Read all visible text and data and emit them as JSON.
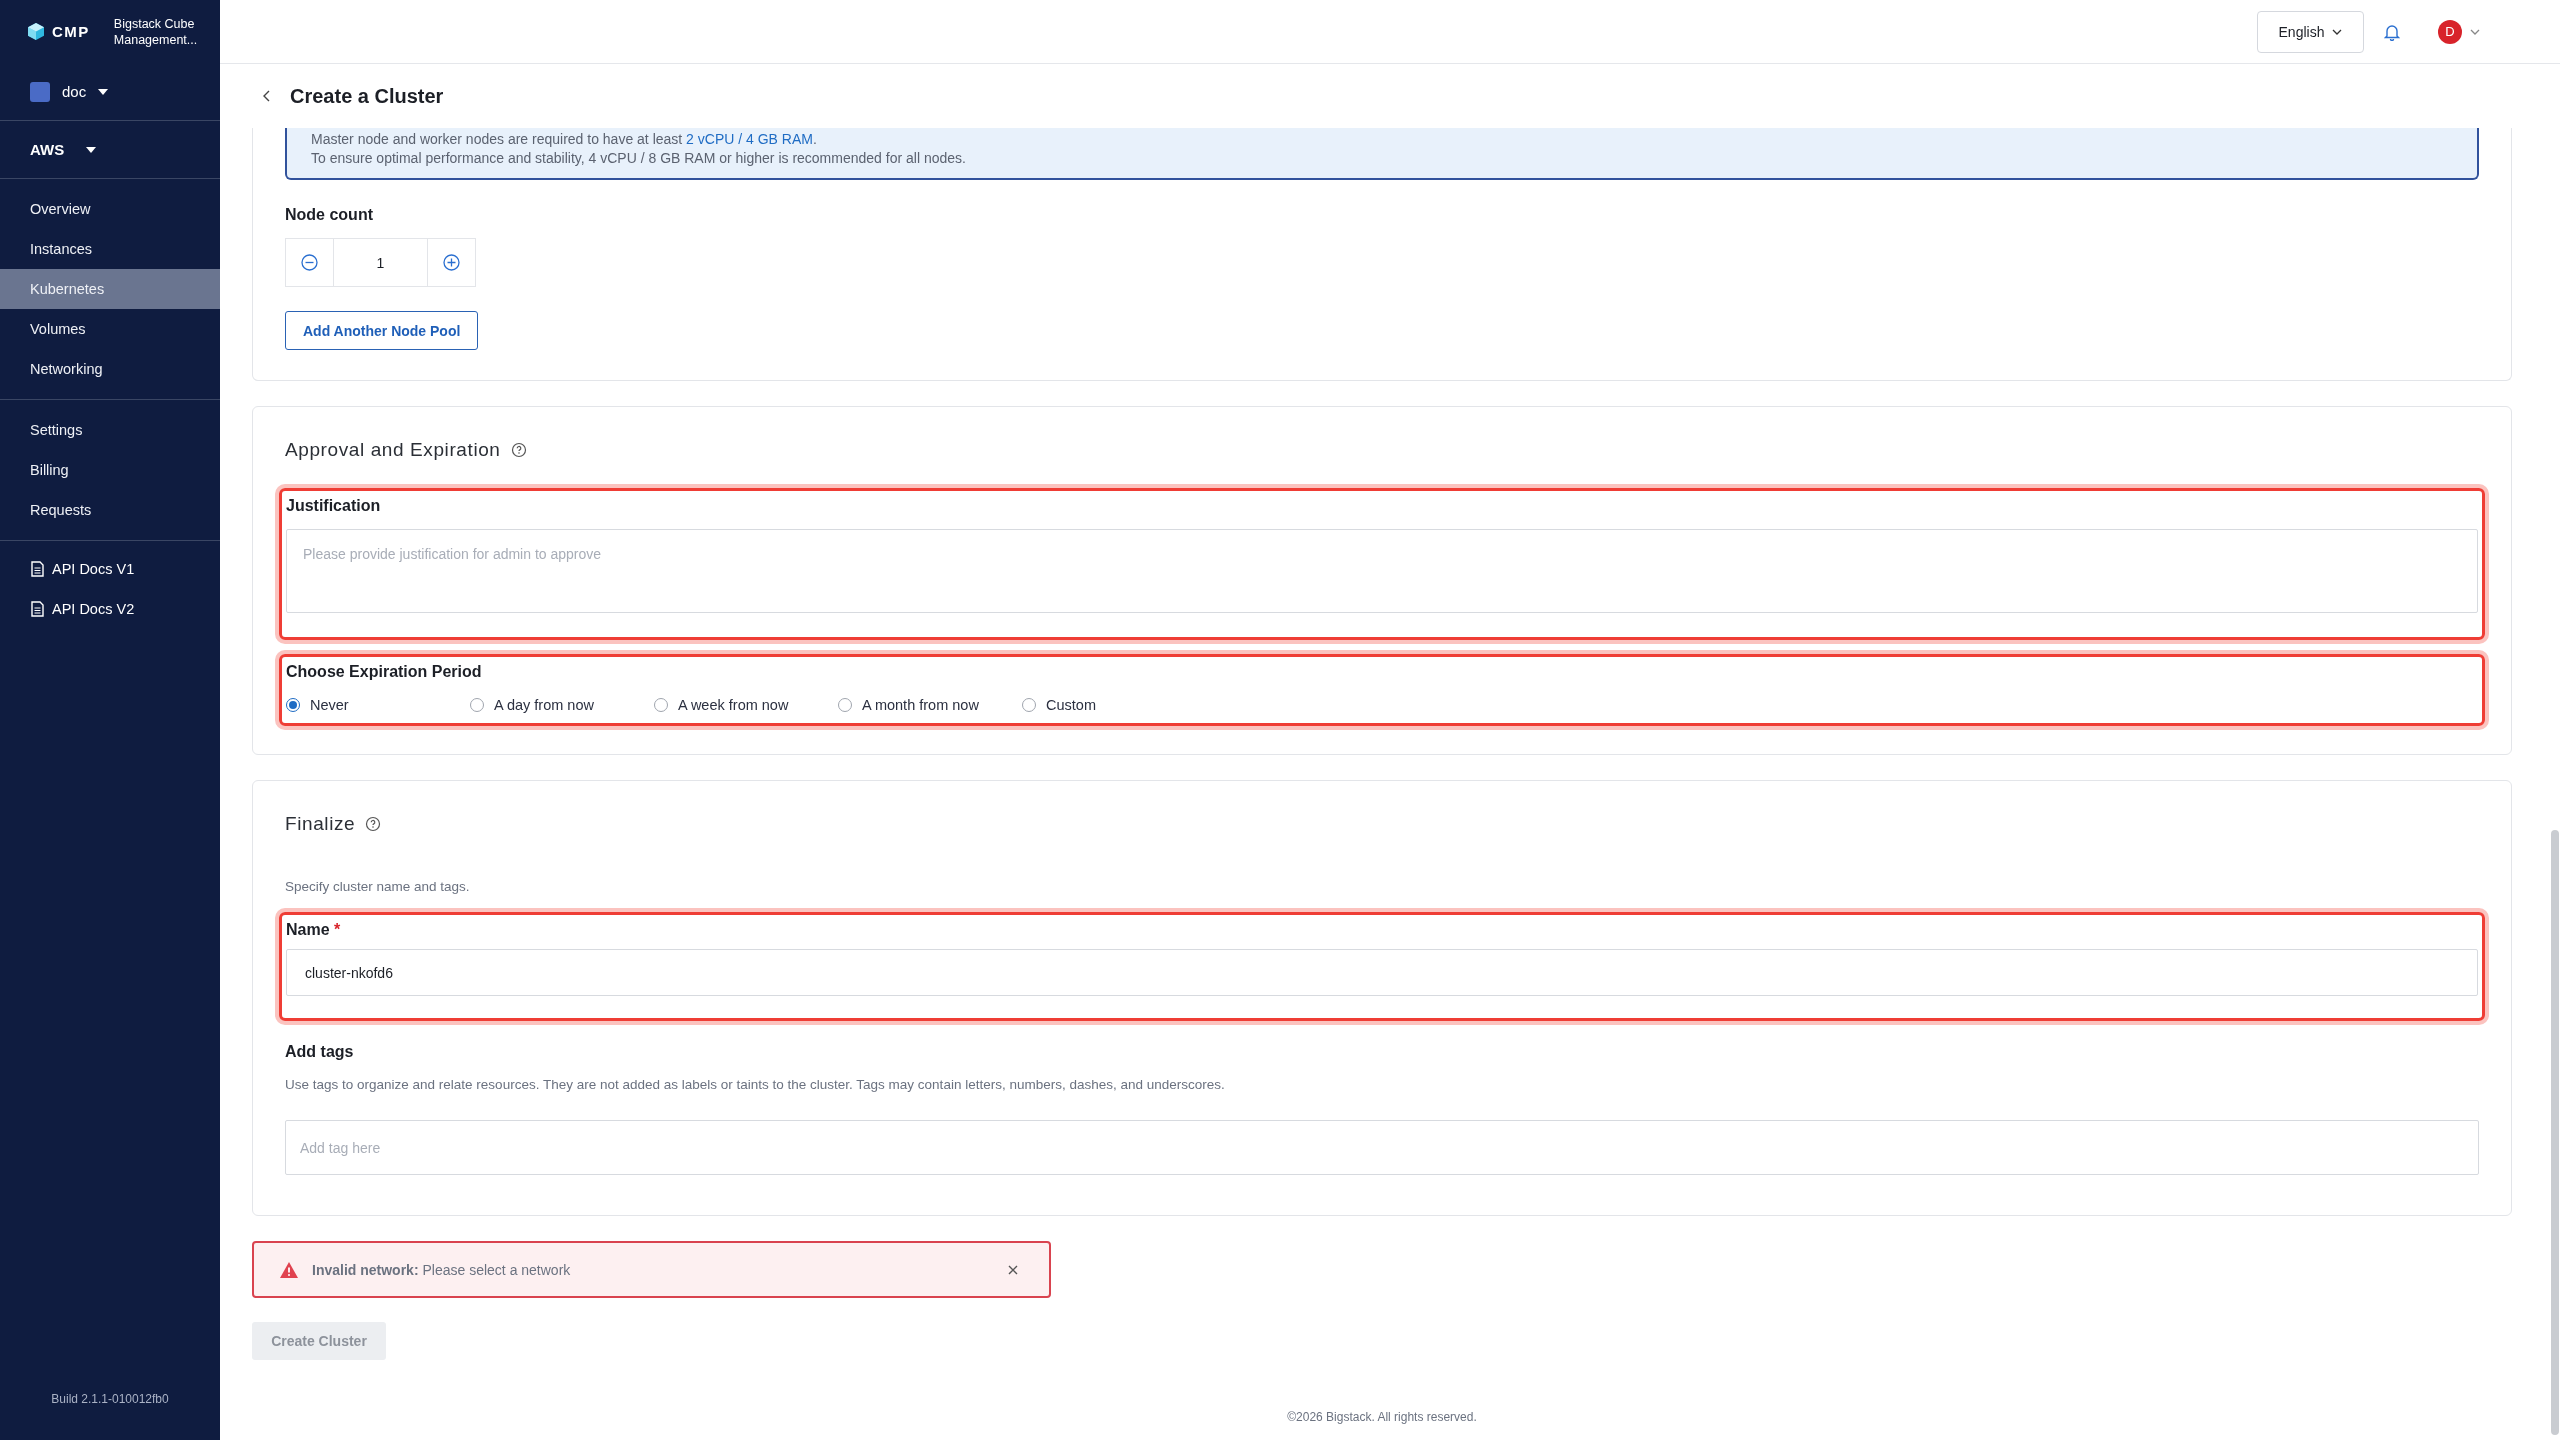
{
  "sidebar": {
    "logo": "CMP",
    "product_lines": [
      "Bigstack Cube",
      "Management..."
    ],
    "project": "doc",
    "provider": "AWS",
    "nav_groups": [
      [
        {
          "label": "Overview",
          "selected": false
        },
        {
          "label": "Instances",
          "selected": false
        },
        {
          "label": "Kubernetes",
          "selected": true
        },
        {
          "label": "Volumes",
          "selected": false
        },
        {
          "label": "Networking",
          "selected": false
        }
      ],
      [
        {
          "label": "Settings",
          "selected": false
        },
        {
          "label": "Billing",
          "selected": false
        },
        {
          "label": "Requests",
          "selected": false
        }
      ]
    ],
    "docs": [
      {
        "label": "API Docs V1"
      },
      {
        "label": "API Docs V2"
      }
    ],
    "build": "Build 2.1.1-010012fb0"
  },
  "header": {
    "language": "English",
    "avatar": "D"
  },
  "page": {
    "title": "Create a Cluster"
  },
  "info_box": {
    "lines": [
      {
        "text": "Master node and worker nodes are required to have at least ",
        "emphasis": "2 vCPU / 4 GB RAM",
        "suffix": "."
      },
      {
        "text": "To ensure optimal performance and stability, 4 vCPU / 8 GB RAM or higher is recommended for all nodes."
      }
    ]
  },
  "node_count": {
    "label": "Node count",
    "value": "1"
  },
  "add_pool_button": "Add Another Node Pool",
  "approval": {
    "title": "Approval and Expiration",
    "justification": {
      "label": "Justification",
      "placeholder": "Please provide justification for admin to approve",
      "highlighted": true
    },
    "expiration": {
      "label": "Choose Expiration Period",
      "highlighted": true,
      "options": [
        {
          "label": "Never",
          "selected": true
        },
        {
          "label": "A day from now",
          "selected": false
        },
        {
          "label": "A week from now",
          "selected": false
        },
        {
          "label": "A month from now",
          "selected": false
        },
        {
          "label": "Custom",
          "selected": false
        }
      ]
    }
  },
  "finalize": {
    "title": "Finalize",
    "description": "Specify cluster name and tags.",
    "name": {
      "label": "Name",
      "required_mark": "*",
      "value": "cluster-nkofd6",
      "highlighted": true
    },
    "tags": {
      "label": "Add tags",
      "description": "Use tags to organize and relate resources. They are not added as labels or taints to the cluster. Tags may contain letters, numbers, dashes, and underscores.",
      "placeholder": "Add tag here"
    }
  },
  "alert": {
    "text": "**Invalid network:** Please select a network"
  },
  "create_button": {
    "label": "Create Cluster",
    "disabled": true
  },
  "footer": "©2026 Bigstack. All rights reserved."
}
